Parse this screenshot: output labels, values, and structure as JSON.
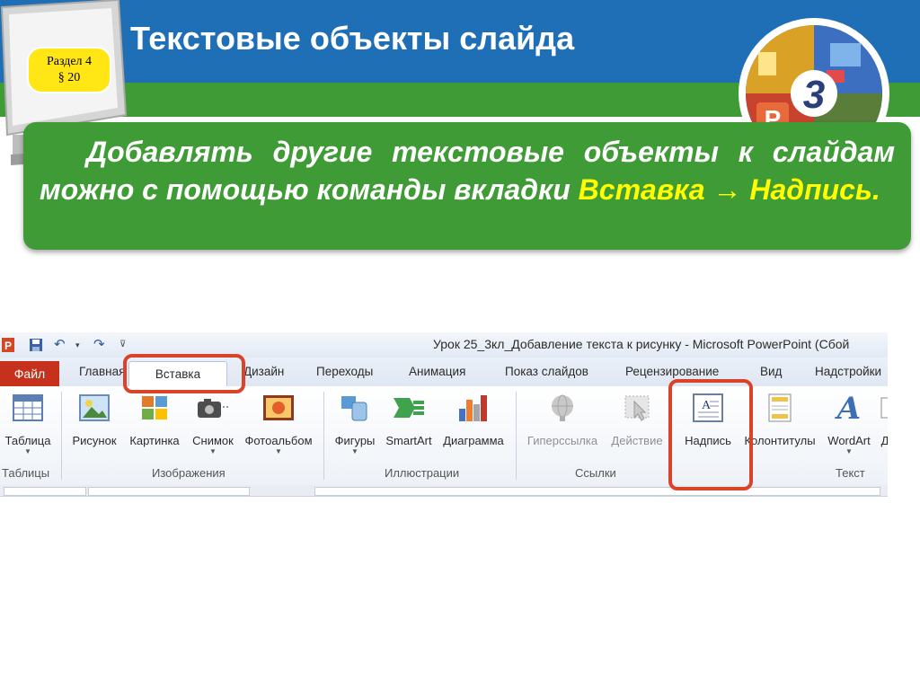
{
  "header": {
    "title": "Текстовые объекты слайда",
    "section_line1": "Раздел 4",
    "section_line2": "§ 20",
    "grade_number": "3"
  },
  "info": {
    "text_main": "Добавлять другие текстовые объекты к слайдам можно с помощью команды вкладки",
    "highlight": "Вставка → Надпись."
  },
  "ribbon": {
    "window_title": "Урок 25_3кл_Добавление текста к рисунку - Microsoft PowerPoint (Сбой",
    "tabs": {
      "file": "Файл",
      "home": "Главная",
      "insert": "Вставка",
      "design": "Дизайн",
      "transitions": "Переходы",
      "animation": "Анимация",
      "slideshow": "Показ слайдов",
      "review": "Рецензирование",
      "view": "Вид",
      "addins": "Надстройки"
    },
    "buttons": {
      "table": "Таблица",
      "picture": "Рисунок",
      "clipart": "Картинка",
      "screenshot": "Снимок",
      "photoalbum": "Фотоальбом",
      "shapes": "Фигуры",
      "smartart": "SmartArt",
      "chart": "Диаграмма",
      "hyperlink": "Гиперссылка",
      "action": "Действие",
      "textbox": "Надпись",
      "headerfooter": "Колонтитулы",
      "wordart": "WordArt",
      "cut_partial": "Д"
    },
    "groups": {
      "tables": "Таблицы",
      "images": "Изображения",
      "illustrations": "Иллюстрации",
      "links": "Ссылки",
      "text": "Текст"
    }
  },
  "colors": {
    "header_blue": "#1f6fb6",
    "accent_green": "#3f9b35",
    "highlight_yellow": "#ffff00",
    "callout_red": "#d9432a"
  }
}
